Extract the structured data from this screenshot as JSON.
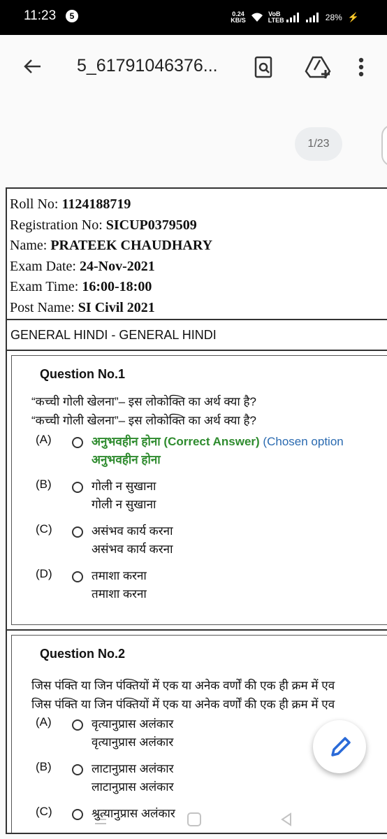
{
  "status": {
    "time": "11:23",
    "notif_count": "5",
    "speed_value": "0.24",
    "speed_unit": "KB/S",
    "lte": "VoB LTEB",
    "battery": "28%"
  },
  "toolbar": {
    "title": "5_61791046376..."
  },
  "page_indicator": "1/23",
  "info": {
    "roll_label": "Roll No: ",
    "roll_value": "1124188719",
    "reg_label": "Registration No: ",
    "reg_value": "SICUP0379509",
    "name_label": "Name: ",
    "name_value": "PRATEEK CHAUDHARY",
    "date_label": "Exam Date: ",
    "date_value": "24-Nov-2021",
    "time_label": "Exam Time: ",
    "time_value": "16:00-18:00",
    "post_label": "Post Name: ",
    "post_value": "SI Civil 2021"
  },
  "section": "GENERAL HINDI - GENERAL HINDI",
  "q1": {
    "title": "Question No.1",
    "text1": "“कच्ची गोली खेलना”– इस लोकोक्ति का अर्थ क्या है?",
    "text2": "“कच्ची गोली खेलना”– इस लोकोक्ति का अर्थ क्या है?",
    "options": [
      {
        "letter": "(A)",
        "line1": "अनुभवहीन होना",
        "correct_tag": " (Correct Answer)",
        "chosen_tag": " (Chosen option",
        "line2": "अनुभवहीन होना"
      },
      {
        "letter": "(B)",
        "line1": "गोली न सुखाना",
        "line2": "गोली न सुखाना"
      },
      {
        "letter": "(C)",
        "line1": "असंभव कार्य करना",
        "line2": "असंभव कार्य करना"
      },
      {
        "letter": "(D)",
        "line1": "तमाशा करना",
        "line2": "तमाशा करना"
      }
    ]
  },
  "q2": {
    "title": "Question No.2",
    "text1": "जिस पंक्ति या जिन पंक्तियों में एक या अनेक वर्णों की एक ही क्रम में एव",
    "text2": "जिस पंक्ति या जिन पंक्तियों में एक या अनेक वर्णों की एक ही क्रम में एव",
    "options": [
      {
        "letter": "(A)",
        "line1": "वृत्यानुप्रास अलंकार",
        "line2": "वृत्यानुप्रास अलंकार"
      },
      {
        "letter": "(B)",
        "line1": "लाटानुप्रास अलंकार",
        "line2": "लाटानुप्रास अलंकार"
      },
      {
        "letter": "(C)",
        "line1": "श्रुत्यानुप्रास अलंकार"
      }
    ]
  }
}
